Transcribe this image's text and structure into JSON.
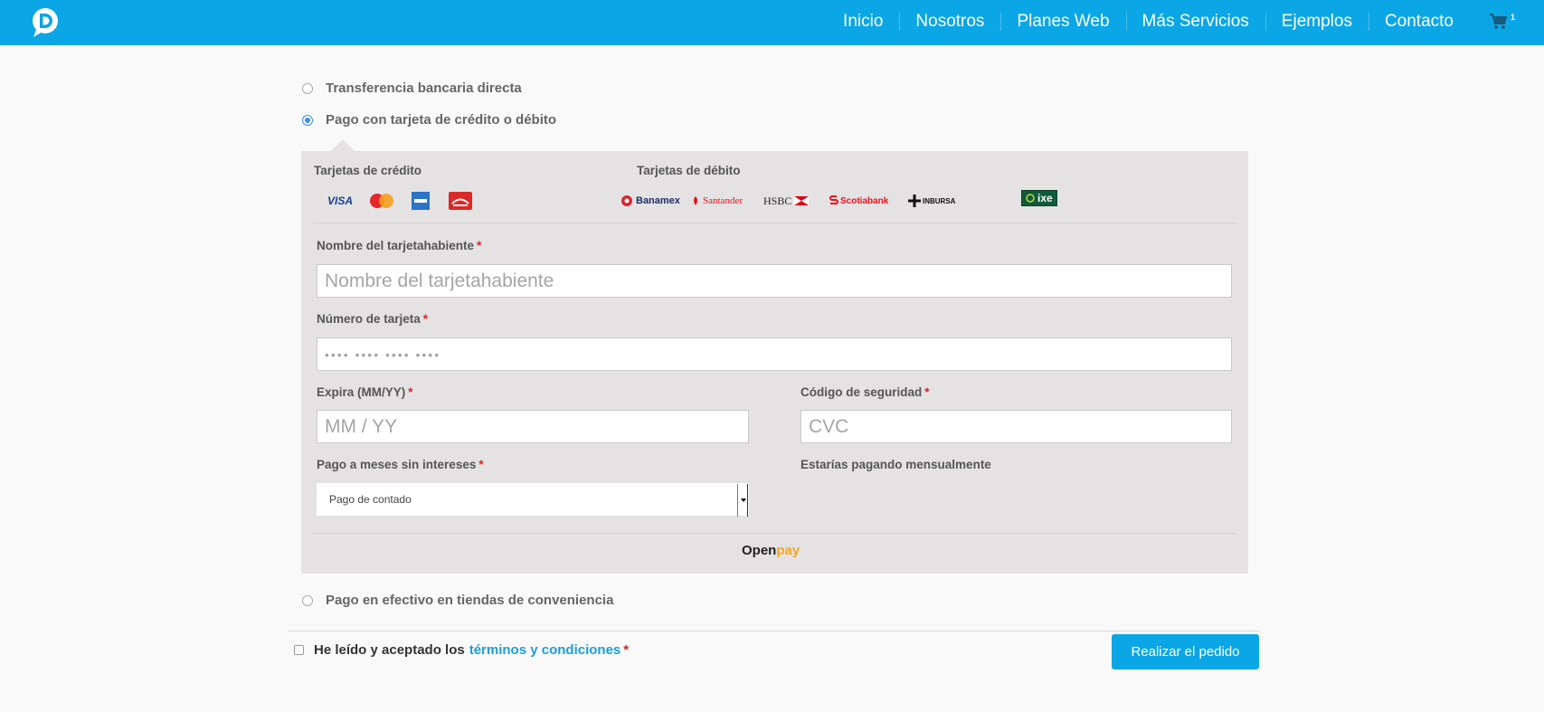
{
  "header": {
    "nav": [
      "Inicio",
      "Nosotros",
      "Planes Web",
      "Más Servicios",
      "Ejemplos",
      "Contacto"
    ],
    "cart_count": "1"
  },
  "payment": {
    "options": {
      "bank_transfer": "Transferencia bancaria directa",
      "card": "Pago con tarjeta de crédito o débito",
      "cash": "Pago en efectivo en tiendas de conveniencia"
    },
    "selected": "card"
  },
  "card_form": {
    "credit_title": "Tarjetas de crédito",
    "debit_title": "Tarjetas de débito",
    "credit_cards": [
      "visa-logo",
      "mastercard-logo",
      "amex-logo",
      "carnet-logo"
    ],
    "credit_visa_text": "VISA",
    "debit_banks": [
      "Banamex",
      "Santander",
      "HSBC",
      "Scotiabank",
      "INBURSA",
      "ixe"
    ],
    "holder_label": "Nombre del tarjetahabiente",
    "holder_placeholder": "Nombre del tarjetahabiente",
    "number_label": "Número de tarjeta",
    "number_placeholder": "•••• •••• •••• ••••",
    "expiry_label": "Expira (MM/YY)",
    "expiry_placeholder": "MM / YY",
    "cvc_label": "Código de seguridad",
    "cvc_placeholder": "CVC",
    "installments_label": "Pago a meses sin intereses",
    "installments_value": "Pago de contado",
    "monthly_label": "Estarías pagando mensualmente",
    "required_mark": "*",
    "provider_o": "O",
    "provider_pen": "pen",
    "provider_pay": "pay"
  },
  "footer": {
    "terms_text": "He leído y aceptado los",
    "terms_link": "términos y condiciones",
    "submit_label": "Realizar el pedido"
  },
  "colors": {
    "brand": "#0ba6e6",
    "panel": "#e4e2e3",
    "link": "#1c9ed8",
    "required": "#e02020",
    "radio_selected": "#3a8fe6"
  }
}
